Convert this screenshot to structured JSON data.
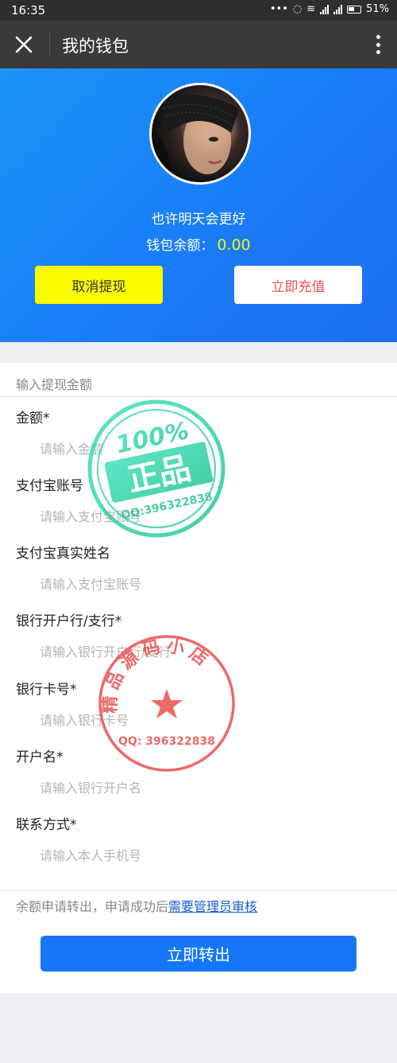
{
  "status_bar": {
    "time": "16:35",
    "battery": "51%"
  },
  "header": {
    "title": "我的钱包",
    "close_icon": "close-icon",
    "more_icon": "more-vertical-icon"
  },
  "profile": {
    "username": "也许明天会更好",
    "balance_label": "钱包余额：",
    "balance_value": "0.00",
    "balance_color": "#f8f200"
  },
  "actions": {
    "cancel_label": "取消提现",
    "recharge_label": "立即充值"
  },
  "form": {
    "section_title": "输入提现金额",
    "fields": [
      {
        "label": "金额*",
        "placeholder": "请输入金额"
      },
      {
        "label": "支付宝账号",
        "placeholder": "请输入支付宝账号"
      },
      {
        "label": "支付宝真实姓名",
        "placeholder": "请输入支付宝账号"
      },
      {
        "label": "银行开户行/支行*",
        "placeholder": "请输入银行开户行/支行"
      },
      {
        "label": "银行卡号*",
        "placeholder": "请输入银行卡号"
      },
      {
        "label": "开户名*",
        "placeholder": "请输入银行开户名"
      },
      {
        "label": "联系方式*",
        "placeholder": "请输入本人手机号"
      }
    ],
    "notice_text": "余额申请转出，申请成功后",
    "notice_link": "需要管理员审核",
    "submit_label": "立即转出"
  },
  "watermarks": {
    "green_stamp": {
      "top": "100%",
      "main": "正品",
      "qq": "QQ:396322838"
    },
    "red_stamp": {
      "arc": "精品源码小店",
      "qq": "QQ: 396322838"
    }
  },
  "colors": {
    "accent": "#1577f8",
    "hero": "#1a7af8",
    "cancel_bg": "#fafa00",
    "recharge_text": "#f05050"
  }
}
